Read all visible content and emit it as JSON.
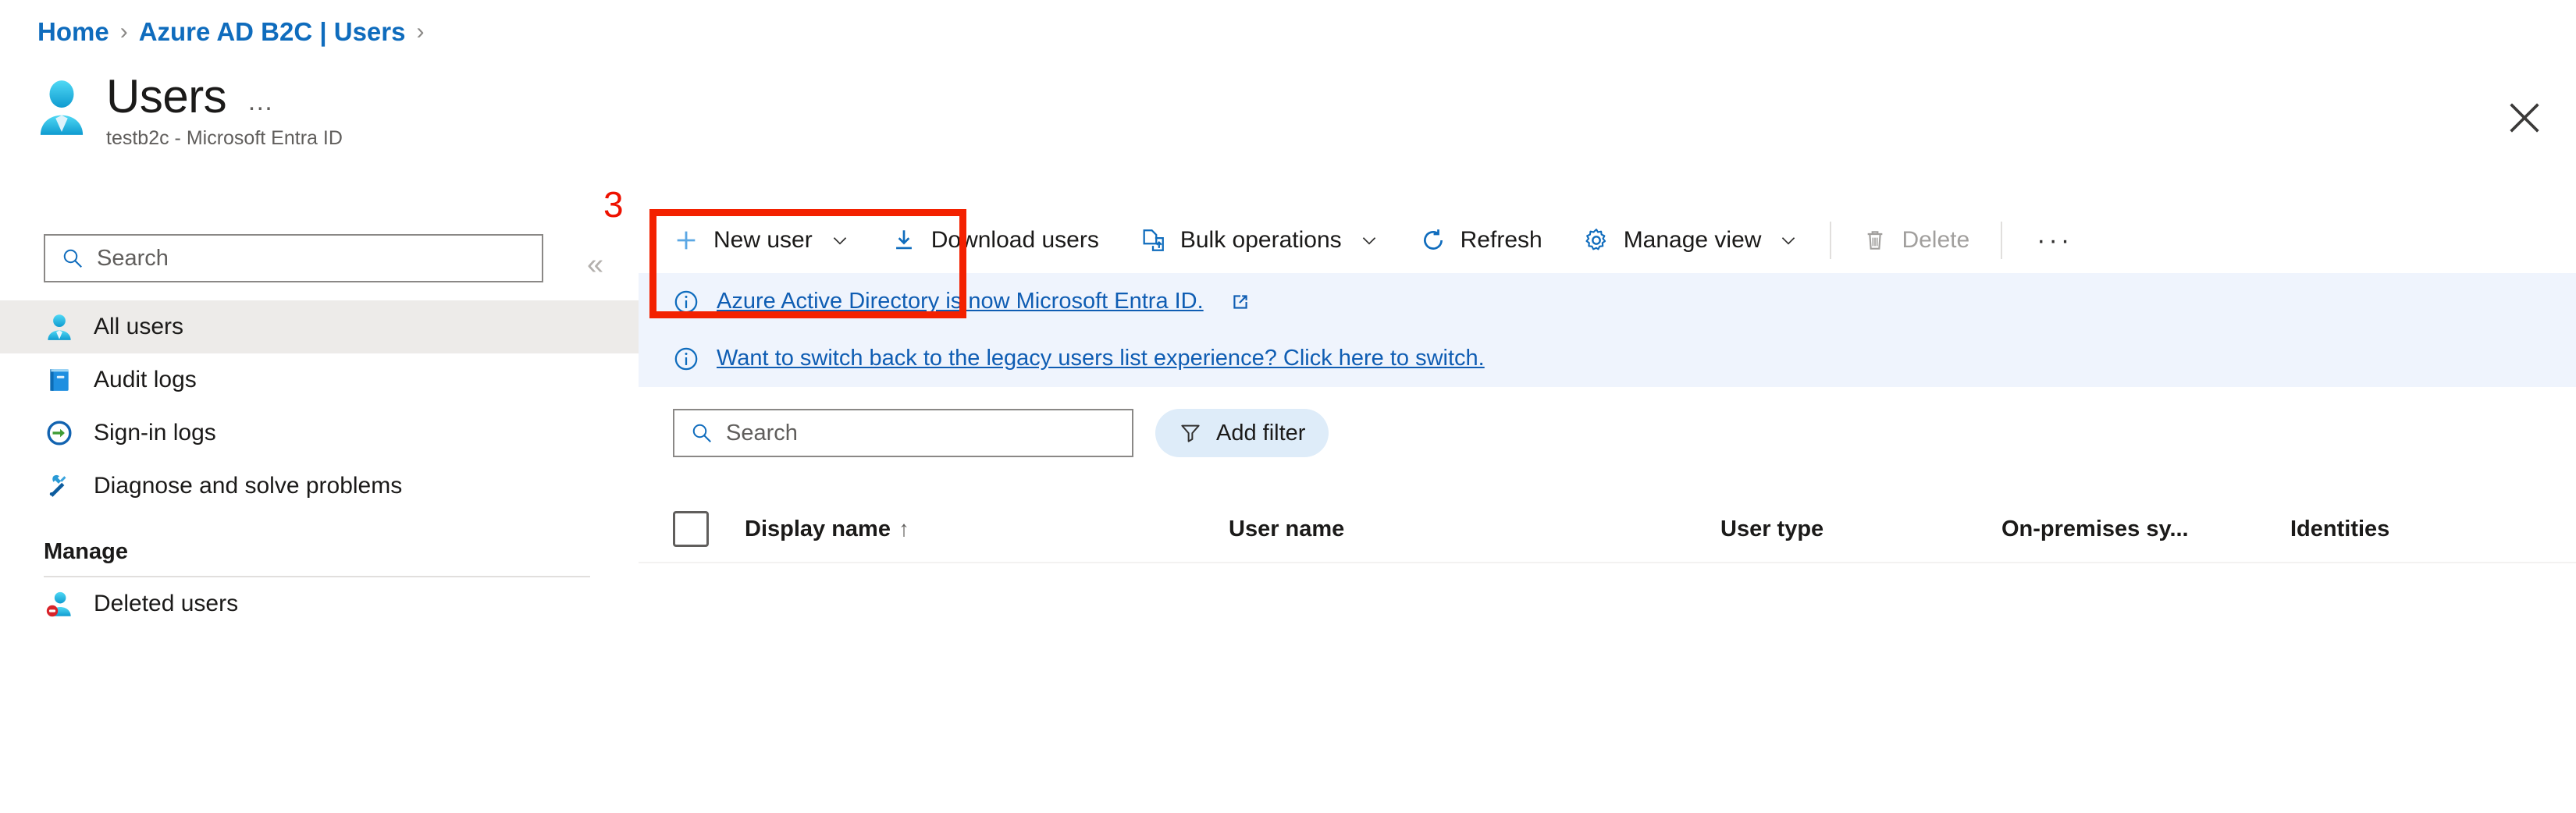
{
  "breadcrumb": {
    "items": [
      "Home",
      "Azure AD B2C | Users"
    ],
    "separator": "›"
  },
  "header": {
    "title": "Users",
    "subtitle": "testb2c - Microsoft Entra ID",
    "ellipsis": "…",
    "icon": "user-avatar-icon",
    "close_icon": "close-icon"
  },
  "sidebar": {
    "search": {
      "placeholder": "Search",
      "value": "",
      "icon": "search-icon"
    },
    "collapse": "«",
    "items": [
      {
        "label": "All users",
        "icon": "user-icon",
        "selected": true
      },
      {
        "label": "Audit logs",
        "icon": "book-icon",
        "selected": false
      },
      {
        "label": "Sign-in logs",
        "icon": "sign-in-icon",
        "selected": false
      },
      {
        "label": "Diagnose and solve problems",
        "icon": "tools-icon",
        "selected": false
      }
    ],
    "group_label": "Manage",
    "group_items": [
      {
        "label": "Deleted users",
        "icon": "deleted-user-icon",
        "selected": false
      }
    ]
  },
  "toolbar": {
    "new_user": "New user",
    "download_users": "Download users",
    "bulk_operations": "Bulk operations",
    "refresh": "Refresh",
    "manage_view": "Manage view",
    "delete": "Delete",
    "more": "···",
    "chevron": "⌄"
  },
  "annotation": {
    "number": "3",
    "color": "#ee1100",
    "target": "new-user-button"
  },
  "banners": [
    {
      "text": "Azure Active Directory is now Microsoft Entra ID.",
      "icon": "info-icon",
      "external": true
    },
    {
      "text": "Want to switch back to the legacy users list experience? Click here to switch.",
      "icon": "info-icon",
      "external": false
    }
  ],
  "filters": {
    "search": {
      "placeholder": "Search",
      "value": "",
      "icon": "search-icon"
    },
    "add_filter": {
      "label": "Add filter",
      "icon": "filter-icon"
    }
  },
  "table": {
    "columns": [
      {
        "label": "Display name",
        "sort": "↑"
      },
      {
        "label": "User name",
        "sort": ""
      },
      {
        "label": "User type",
        "sort": ""
      },
      {
        "label": "On-premises sy...",
        "sort": ""
      },
      {
        "label": "Identities",
        "sort": ""
      }
    ],
    "rows": []
  },
  "colors": {
    "accent": "#0f6cbd",
    "link": "#0f5db3",
    "banner_bg": "#eff4fd",
    "selected_bg": "#edebe9",
    "annotation": "#ee1100"
  }
}
